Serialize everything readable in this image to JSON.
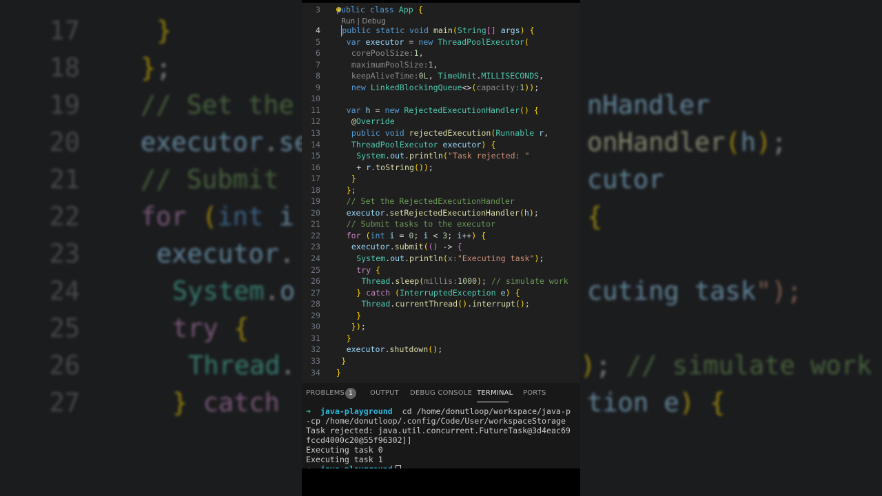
{
  "editor": {
    "codelens": "Run | Debug",
    "active_line": "4",
    "lines": [
      {
        "n": "3",
        "code": "public class App {"
      },
      {
        "n": "4",
        "code": "public static void main(String[] args) {"
      },
      {
        "n": "5",
        "code": "var executor = new ThreadPoolExecutor("
      },
      {
        "n": "6",
        "code": "corePoolSize:1,"
      },
      {
        "n": "7",
        "code": "maximumPoolSize:1,"
      },
      {
        "n": "8",
        "code": "keepAliveTime:0L, TimeUnit.MILLISECONDS,"
      },
      {
        "n": "9",
        "code": "new LinkedBlockingQueue<>(capacity:1));"
      },
      {
        "n": "10",
        "code": ""
      },
      {
        "n": "11",
        "code": "var h = new RejectedExecutionHandler() {"
      },
      {
        "n": "12",
        "code": "@Override"
      },
      {
        "n": "13",
        "code": "public void rejectedExecution(Runnable r,"
      },
      {
        "n": "14",
        "code": "ThreadPoolExecutor executor) {"
      },
      {
        "n": "15",
        "code": "System.out.println(\"Task rejected: \""
      },
      {
        "n": "16",
        "code": "+ r.toString());"
      },
      {
        "n": "17",
        "code": "}"
      },
      {
        "n": "18",
        "code": "};"
      },
      {
        "n": "19",
        "code": "// Set the RejectedExecutionHandler"
      },
      {
        "n": "20",
        "code": "executor.setRejectedExecutionHandler(h);"
      },
      {
        "n": "21",
        "code": "// Submit tasks to the executor"
      },
      {
        "n": "22",
        "code": "for (int i = 0; i < 3; i++) {"
      },
      {
        "n": "23",
        "code": "executor.submit(() -> {"
      },
      {
        "n": "24",
        "code": "System.out.println(x:\"Executing task\");"
      },
      {
        "n": "25",
        "code": "try {"
      },
      {
        "n": "26",
        "code": "Thread.sleep(millis:1000); // simulate work"
      },
      {
        "n": "27",
        "code": "} catch (InterruptedException e) {"
      },
      {
        "n": "28",
        "code": "Thread.currentThread().interrupt();"
      },
      {
        "n": "29",
        "code": "}"
      },
      {
        "n": "30",
        "code": "});"
      },
      {
        "n": "31",
        "code": "}"
      },
      {
        "n": "32",
        "code": "executor.shutdown();"
      },
      {
        "n": "33",
        "code": "}"
      },
      {
        "n": "34",
        "code": "}"
      }
    ]
  },
  "panel": {
    "tabs": [
      "PROBLEMS",
      "OUTPUT",
      "DEBUG CONSOLE",
      "TERMINAL",
      "PORTS"
    ],
    "active_tab": "TERMINAL",
    "problems_count": "1"
  },
  "terminal": {
    "prompt_dir": "java-playground",
    "command": "cd /home/donutloop/workspace/java-p",
    "line2": "-cp /home/donutloop/.config/Code/User/workspaceStorage",
    "line3": "Task rejected: java.util.concurrent.FutureTask@3d4eac69",
    "line4": "fccd4000c20@55f96302]]",
    "line5": "Executing task 0",
    "line6": "Executing task 1"
  },
  "backdrop": {
    "numbers": [
      "17",
      "18",
      "19",
      "20",
      "21",
      "22",
      "23",
      "24",
      "25",
      "26",
      "27"
    ],
    "lines": [
      "}",
      "};",
      "// Set the",
      "executor.se",
      "// Submit",
      "for (int i",
      "executor.",
      "System.o",
      "try {",
      "Thread.",
      "} catch"
    ],
    "right_fragments": [
      "",
      "",
      "nHandler",
      "onHandler(h);",
      "cutor",
      "{",
      "",
      "cuting task\");",
      "",
      "); // simulate work",
      "tion e) {"
    ]
  },
  "colors": {
    "editor_bg": "#1f1f1f",
    "panel_bg": "#181818",
    "keyword": "#569cd6",
    "control": "#c586c0",
    "type": "#4ec9b0",
    "function": "#dcdcaa",
    "variable": "#9cdcfe",
    "string": "#ce9178",
    "comment": "#6a9955",
    "terminal_arrow": "#23d18b",
    "terminal_dir": "#29b8db"
  }
}
